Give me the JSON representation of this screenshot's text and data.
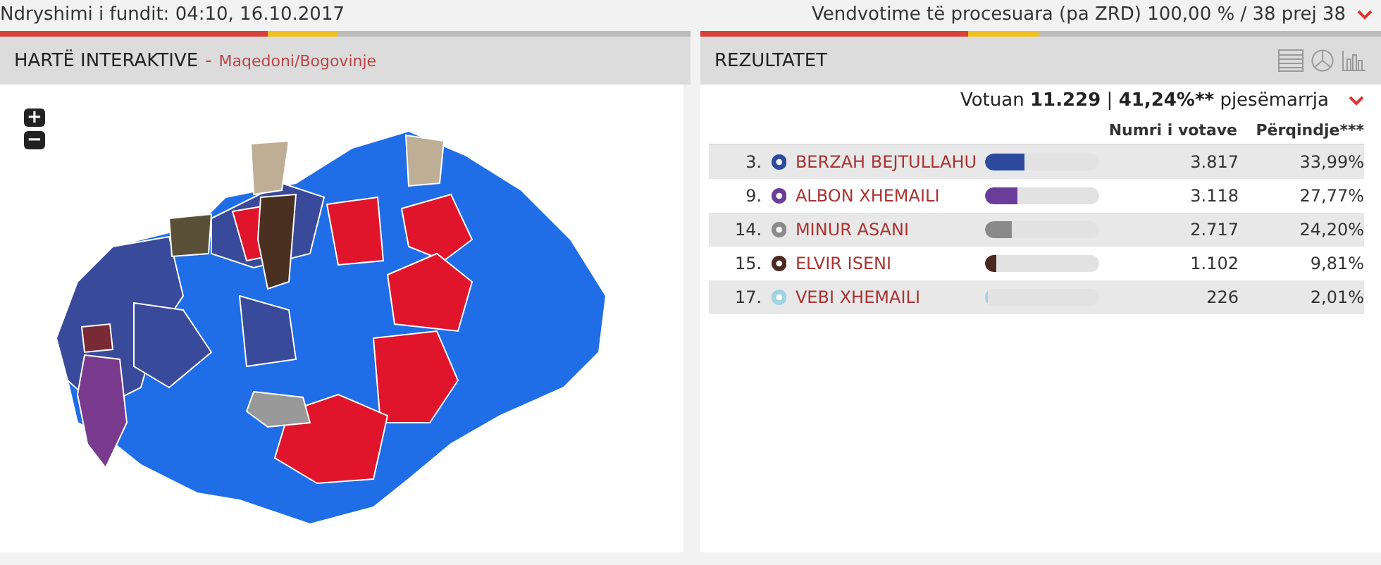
{
  "top_bar": {
    "last_update": "Ndryshimi i fundit: 04:10, 16.10.2017",
    "processed": "Vendvotime të procesuara (pa ZRD) 100,00 % / 38 prej 38"
  },
  "map_panel": {
    "title": "HARTË INTERAKTIVE",
    "separator": "-",
    "breadcrumb": "Maqedoni/Bogovinje",
    "zoom_in": "+",
    "zoom_out": "−"
  },
  "results_panel": {
    "title": "REZULTATET",
    "turnout": {
      "label": "Votuan",
      "votes": "11.229",
      "separator": "|",
      "percent": "41,24%**",
      "suffix": "pjesëmarrja"
    },
    "columns": [
      "Numri i votave",
      "Përqindje***"
    ],
    "rows": [
      {
        "number": "3.",
        "name": "BERZAH BEJTULLAHU",
        "color": "#2e4a9e",
        "level": 0.34,
        "votes": "3.817",
        "percent": "33,99%"
      },
      {
        "number": "9.",
        "name": "ALBON XHEMAILI",
        "color": "#6a3d9a",
        "level": 0.28,
        "votes": "3.118",
        "percent": "27,77%"
      },
      {
        "number": "14.",
        "name": "MINUR ASANI",
        "color": "#8a8a8a",
        "level": 0.24,
        "votes": "2.717",
        "percent": "24,20%"
      },
      {
        "number": "15.",
        "name": "ELVIR ISENI",
        "color": "#4a2a20",
        "level": 0.1,
        "votes": "1.102",
        "percent": "9,81%"
      },
      {
        "number": "17.",
        "name": "VEBI XHEMAILI",
        "color": "#9fd3e0",
        "level": 0.02,
        "votes": "226",
        "percent": "2,01%"
      }
    ]
  }
}
